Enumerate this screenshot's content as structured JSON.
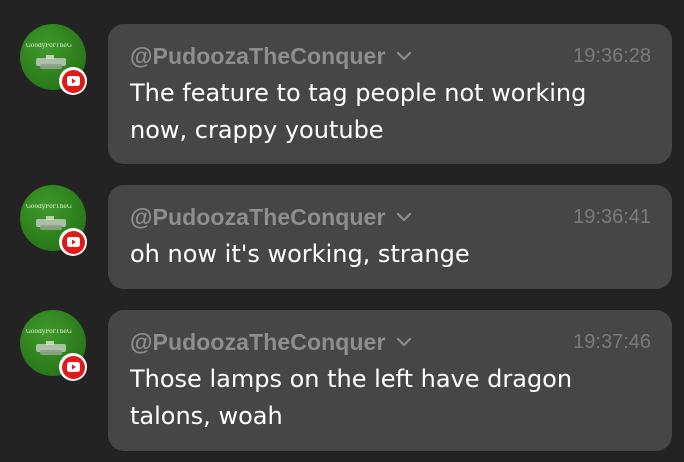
{
  "messages": [
    {
      "author": "@PudoozaTheConquer",
      "time": "19:36:28",
      "text": "The feature to tag people not working now, crappy youtube",
      "avatar_text": "GoodyForTheGood",
      "badge_icon": "youtube-icon"
    },
    {
      "author": "@PudoozaTheConquer",
      "time": "19:36:41",
      "text": "oh now it's working, strange",
      "avatar_text": "GoodyForTheGood",
      "badge_icon": "youtube-icon"
    },
    {
      "author": "@PudoozaTheConquer",
      "time": "19:37:46",
      "text": "Those lamps on the left have dragon talons, woah",
      "avatar_text": "GoodyForTheGood",
      "badge_icon": "youtube-icon"
    }
  ],
  "colors": {
    "background": "#232323",
    "bubble": "#464646",
    "author": "#8e8e8e",
    "timestamp": "#7a7a7a",
    "text": "#ffffff",
    "avatar": "#2c7d1c",
    "youtube": "#e0191b"
  }
}
